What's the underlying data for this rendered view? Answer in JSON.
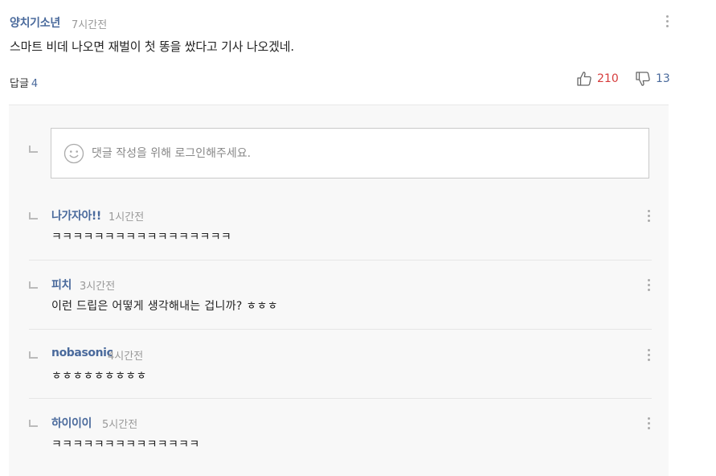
{
  "comment": {
    "author": "양치기소년",
    "time": "7시간전",
    "text": "스마트 비데 나오면 재벌이 첫 똥을 쌌다고 기사 나오겠네.",
    "reply_label": "답글",
    "reply_count": "4",
    "likes": "210",
    "dislikes": "13"
  },
  "reply_box": {
    "placeholder": "댓글 작성을 위해 로그인해주세요."
  },
  "replies": [
    {
      "author": "나가자아!!",
      "time": "1시간전",
      "text": "ㅋㅋㅋㅋㅋㅋㅋㅋㅋㅋㅋㅋㅋㅋㅋㅋㅋ"
    },
    {
      "author": "피치",
      "time": "3시간전",
      "text": "이런 드립은 어떻게 생각해내는 겁니까? ㅎㅎㅎ"
    },
    {
      "author": "nobasonic",
      "time": "4시간전",
      "text": "ㅎㅎㅎㅎㅎㅎㅎㅎㅎ"
    },
    {
      "author": "하이이이",
      "time": "5시간전",
      "text": "ㅋㅋㅋㅋㅋㅋㅋㅋㅋㅋㅋㅋㅋㅋ"
    }
  ],
  "colors": {
    "author": "#4a6a9c",
    "like": "#d63c3c",
    "dislike": "#4a6a9c",
    "reply_background": "#f8f8f8"
  },
  "icons": [
    "more-icon",
    "thumbs-up-icon",
    "thumbs-down-icon",
    "reply-arrow-icon",
    "smiley-icon"
  ]
}
